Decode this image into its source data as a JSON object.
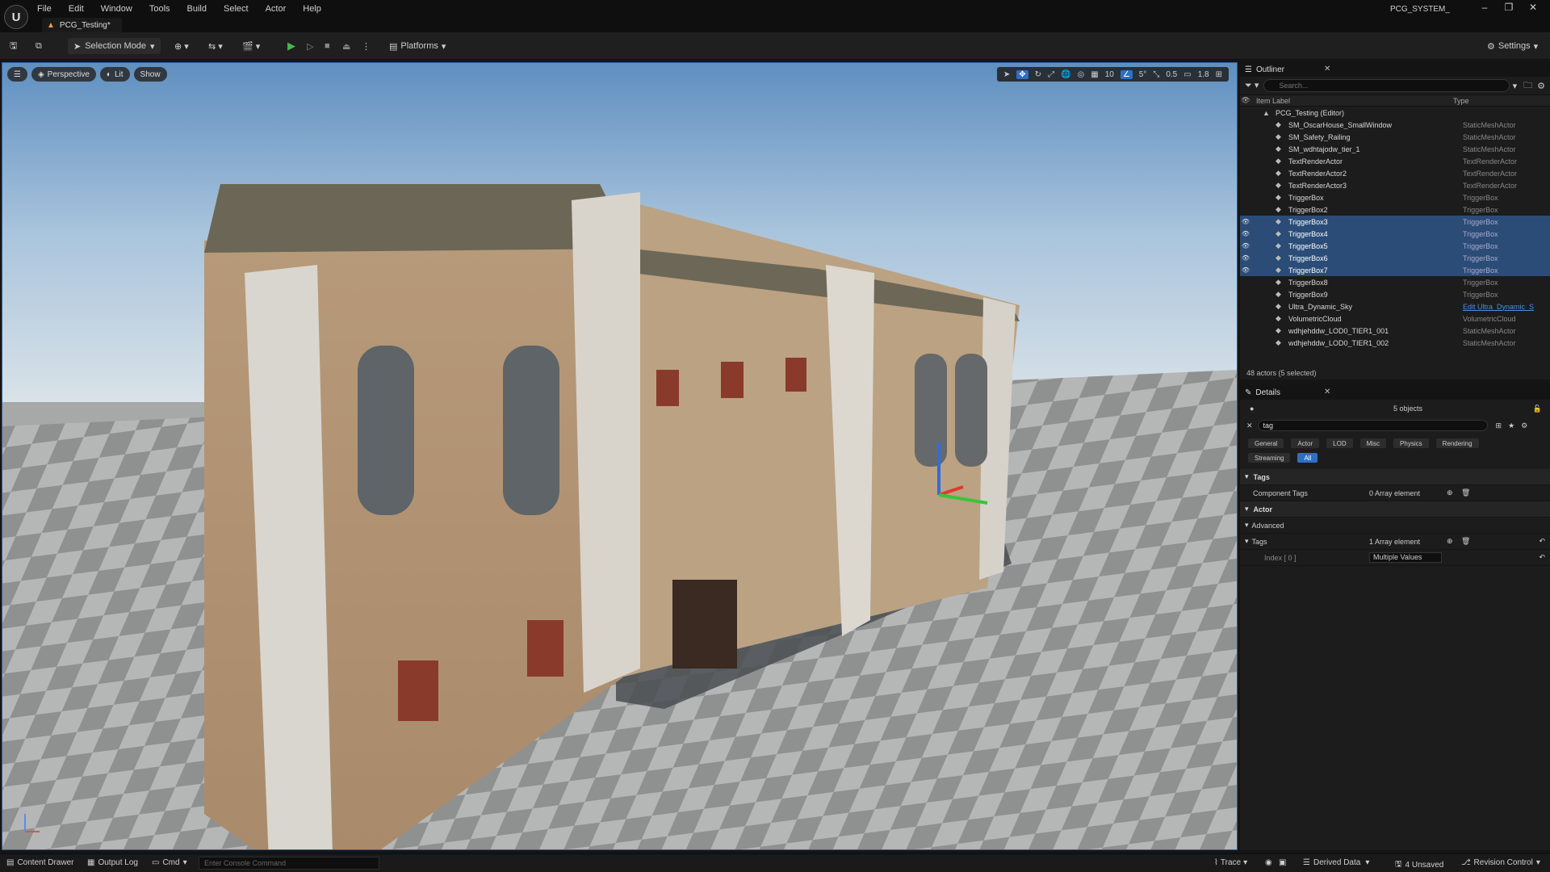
{
  "app": {
    "title_logo": "U",
    "project_name": "PCG_SYSTEM_",
    "document_tab": "PCG_Testing*"
  },
  "menu": [
    "File",
    "Edit",
    "Window",
    "Tools",
    "Build",
    "Select",
    "Actor",
    "Help"
  ],
  "toolbar": {
    "selection_mode": "Selection Mode",
    "platforms": "Platforms",
    "settings": "Settings"
  },
  "viewport": {
    "perspective": "Perspective",
    "lit": "Lit",
    "show": "Show",
    "grid_snap": "10",
    "rotation_snap": "5°",
    "scale_snap": "0.5",
    "camera_speed": "1.8"
  },
  "outliner": {
    "title": "Outliner",
    "search_placeholder": "Search...",
    "col_label": "Item Label",
    "col_type": "Type",
    "root": "PCG_Testing (Editor)",
    "rows": [
      {
        "label": "SM_OscarHouse_SmallWindow",
        "type": "StaticMeshActor",
        "selected": false
      },
      {
        "label": "SM_Safety_Railing",
        "type": "StaticMeshActor",
        "selected": false
      },
      {
        "label": "SM_wdhtajodw_tier_1",
        "type": "StaticMeshActor",
        "selected": false
      },
      {
        "label": "TextRenderActor",
        "type": "TextRenderActor",
        "selected": false
      },
      {
        "label": "TextRenderActor2",
        "type": "TextRenderActor",
        "selected": false
      },
      {
        "label": "TextRenderActor3",
        "type": "TextRenderActor",
        "selected": false
      },
      {
        "label": "TriggerBox",
        "type": "TriggerBox",
        "selected": false
      },
      {
        "label": "TriggerBox2",
        "type": "TriggerBox",
        "selected": false
      },
      {
        "label": "TriggerBox3",
        "type": "TriggerBox",
        "selected": true
      },
      {
        "label": "TriggerBox4",
        "type": "TriggerBox",
        "selected": true
      },
      {
        "label": "TriggerBox5",
        "type": "TriggerBox",
        "selected": true
      },
      {
        "label": "TriggerBox6",
        "type": "TriggerBox",
        "selected": true
      },
      {
        "label": "TriggerBox7",
        "type": "TriggerBox",
        "selected": true
      },
      {
        "label": "TriggerBox8",
        "type": "TriggerBox",
        "selected": false
      },
      {
        "label": "TriggerBox9",
        "type": "TriggerBox",
        "selected": false
      },
      {
        "label": "Ultra_Dynamic_Sky",
        "type": "Edit Ultra_Dynamic_S",
        "selected": false
      },
      {
        "label": "VolumetricCloud",
        "type": "VolumetricCloud",
        "selected": false
      },
      {
        "label": "wdhjehddw_LOD0_TIER1_001",
        "type": "StaticMeshActor",
        "selected": false
      },
      {
        "label": "wdhjehddw_LOD0_TIER1_002",
        "type": "StaticMeshActor",
        "selected": false
      }
    ],
    "count": "48 actors (5 selected)"
  },
  "details": {
    "title": "Details",
    "objects": "5 objects",
    "search_value": "tag",
    "filters_row1": [
      "General",
      "Actor",
      "LOD",
      "Misc",
      "Physics",
      "Rendering"
    ],
    "filters_row2": [
      "Streaming",
      "All"
    ],
    "cat_tags": "Tags",
    "component_tags": "Component Tags",
    "component_tags_value": "0 Array element",
    "cat_actor": "Actor",
    "advanced": "Advanced",
    "tags": "Tags",
    "tags_value": "1 Array element",
    "index0": "Index [ 0 ]",
    "index0_value": "Multiple Values"
  },
  "statusbar": {
    "content_drawer": "Content Drawer",
    "output_log": "Output Log",
    "cmd": "Cmd",
    "console_placeholder": "Enter Console Command",
    "trace": "Trace",
    "derived_data": "Derived Data",
    "unsaved": "4 Unsaved",
    "revision_control": "Revision Control"
  },
  "colors": {
    "accent": "#2e6fc4",
    "selection": "#2a4c77",
    "play": "#4cb54c"
  }
}
